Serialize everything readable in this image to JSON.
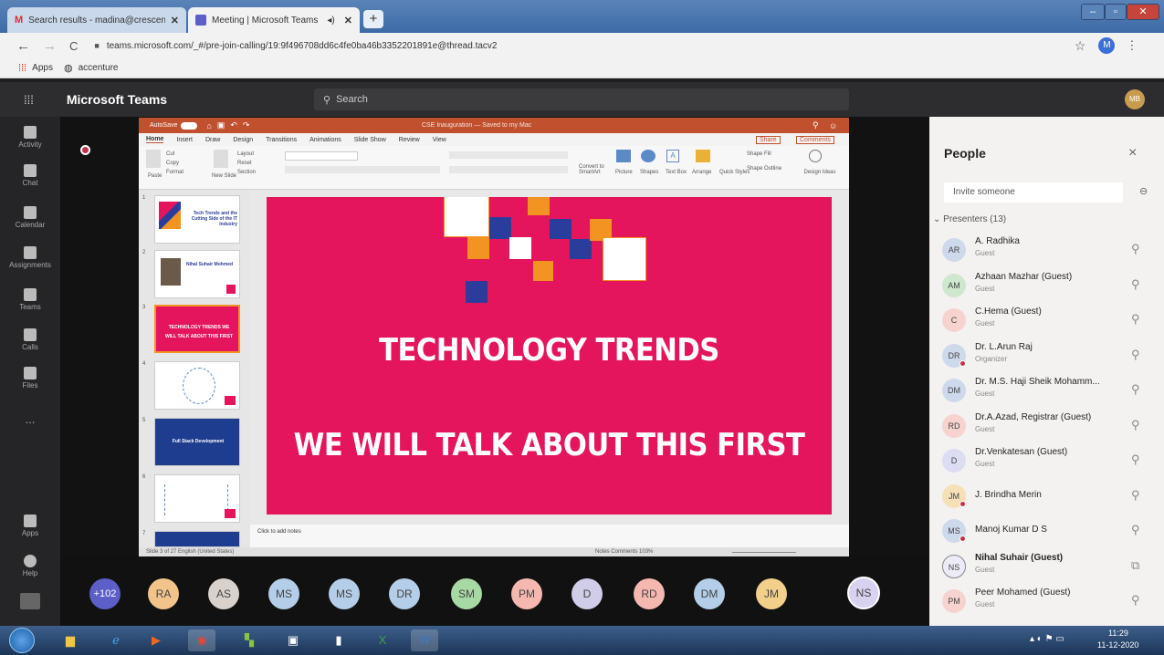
{
  "browser": {
    "tabs": [
      {
        "title": "Search results - madina@crescen",
        "active": false
      },
      {
        "title": "Meeting | Microsoft Teams",
        "active": true
      }
    ],
    "new_tab": "+",
    "url": "teams.microsoft.com/_#/pre-join-calling/19:9f496708dd6c4fe0ba46b3352201891e@thread.tacv2",
    "bookmarks": [
      "Apps",
      "accenture"
    ],
    "profile_initial": "M"
  },
  "teams": {
    "app_title": "Microsoft Teams",
    "search_placeholder": "Search",
    "user_initials": "MB",
    "rail": [
      "Activity",
      "Chat",
      "Calendar",
      "Assignments",
      "Teams",
      "Calls",
      "Files",
      "...",
      "Apps",
      "Help"
    ]
  },
  "ppt": {
    "title": "CSE Inauguration — Saved to my Mac",
    "autosave": "AutoSave",
    "menu": [
      "Home",
      "Insert",
      "Draw",
      "Design",
      "Transitions",
      "Animations",
      "Slide Show",
      "Review",
      "View"
    ],
    "share": "Share",
    "comments": "Comments",
    "ribbon_labels": [
      "Paste",
      "Cut",
      "Copy",
      "Format",
      "New Slide",
      "Layout",
      "Reset",
      "Section",
      "Convert to SmartArt",
      "Picture",
      "Shapes",
      "Text Box",
      "Arrange",
      "Quick Styles",
      "Shape Fill",
      "Shape Outline",
      "Design Ideas"
    ],
    "thumbnails": [
      {
        "num": "1",
        "text": "Tech Trends and the Cutting Side of the IT Industry"
      },
      {
        "num": "2",
        "text": "Nihal Suhair Mohmed"
      },
      {
        "num": "3",
        "text": "TECHNOLOGY TRENDS  WE WILL TALK ABOUT THIS FIRST"
      },
      {
        "num": "4",
        "text": ""
      },
      {
        "num": "5",
        "text": "Full Stack Development"
      },
      {
        "num": "6",
        "text": ""
      },
      {
        "num": "7",
        "text": ""
      }
    ],
    "slide": {
      "line1": "TECHNOLOGY TRENDS",
      "line2": "WE WILL TALK ABOUT THIS FIRST",
      "bg": "#e4155c"
    },
    "notes": "Click to add notes",
    "status_left": "Slide 3 of 27   English (United States)",
    "status_right": "Notes   Comments   103%"
  },
  "participants_row": [
    {
      "initials": "+102",
      "color": "#5b5fc7"
    },
    {
      "initials": "RA",
      "color": "#f2c48c"
    },
    {
      "initials": "AS",
      "color": "#d9d1cb"
    },
    {
      "initials": "MS",
      "color": "#b4cde8"
    },
    {
      "initials": "MS",
      "color": "#b4cde8"
    },
    {
      "initials": "DR",
      "color": "#b4cde8"
    },
    {
      "initials": "SM",
      "color": "#a7d9a5"
    },
    {
      "initials": "PM",
      "color": "#f4b8b0"
    },
    {
      "initials": "D",
      "color": "#cfcde8"
    },
    {
      "initials": "RD",
      "color": "#f4b8b0"
    },
    {
      "initials": "DM",
      "color": "#b4cde8"
    },
    {
      "initials": "JM",
      "color": "#f2d08c"
    },
    {
      "initials": "NS",
      "color": "#d9d1f0"
    }
  ],
  "people_panel": {
    "title": "People",
    "close": "×",
    "invite_placeholder": "Invite someone",
    "section": "Presenters (13)",
    "people": [
      {
        "initials": "AR",
        "name": "A. Radhika",
        "role": "Guest",
        "color": "#cfd9ec",
        "red_dot": false
      },
      {
        "initials": "AM",
        "name": "Azhaan Mazhar (Guest)",
        "role": "Guest",
        "color": "#cfe7cf",
        "red_dot": false
      },
      {
        "initials": "C",
        "name": "C.Hema (Guest)",
        "role": "Guest",
        "color": "#f6d3cf",
        "red_dot": false
      },
      {
        "initials": "DR",
        "name": "Dr. L.Arun Raj",
        "role": "Organizer",
        "color": "#cfd9ec",
        "red_dot": true
      },
      {
        "initials": "DM",
        "name": "Dr. M.S. Haji Sheik Mohamm...",
        "role": "Guest",
        "color": "#cfd9ec",
        "red_dot": false
      },
      {
        "initials": "RD",
        "name": "Dr.A.Azad, Registrar (Guest)",
        "role": "Guest",
        "color": "#f6d3cf",
        "red_dot": false
      },
      {
        "initials": "D",
        "name": "Dr.Venkatesan (Guest)",
        "role": "Guest",
        "color": "#dcdcf2",
        "red_dot": false
      },
      {
        "initials": "JM",
        "name": "J. Brindha Merin",
        "role": "",
        "color": "#f5e0b8",
        "red_dot": true
      },
      {
        "initials": "MS",
        "name": "Manoj Kumar D S",
        "role": "",
        "color": "#cfd9ec",
        "red_dot": true
      },
      {
        "initials": "NS",
        "name": "Nihal Suhair (Guest)",
        "role": "Guest",
        "color": "#ecebf7",
        "red_dot": false,
        "bold": true
      },
      {
        "initials": "PM",
        "name": "Peer Mohamed (Guest)",
        "role": "Guest",
        "color": "#f6d3cf",
        "red_dot": false
      }
    ]
  },
  "taskbar": {
    "time": "11:29",
    "date": "11-12-2020"
  }
}
